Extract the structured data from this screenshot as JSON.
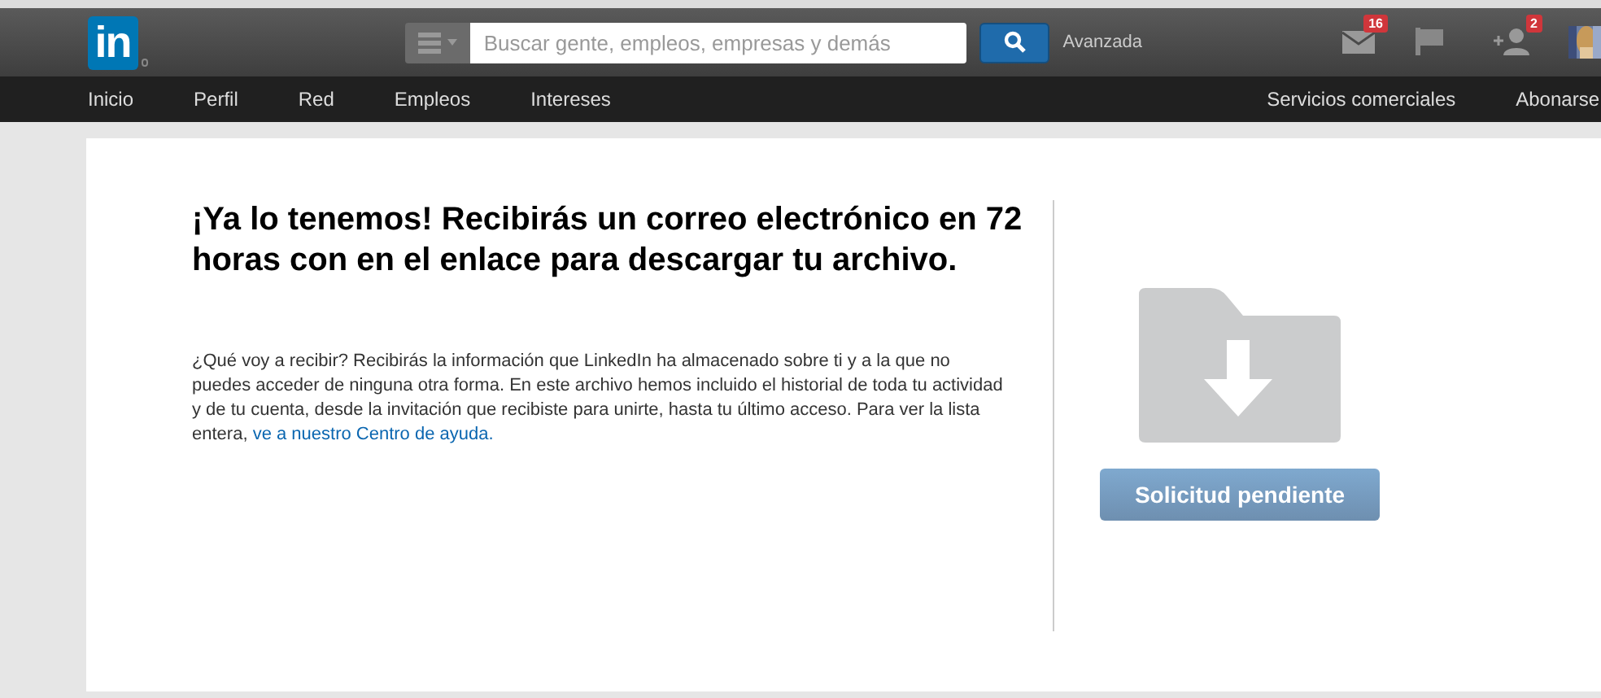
{
  "header": {
    "logo": "in",
    "search": {
      "placeholder": "Buscar gente, empleos, empresas y demás"
    },
    "advanced_link": "Avanzada",
    "notifications": [
      {
        "kind": "mail",
        "count": "16"
      },
      {
        "kind": "flag"
      },
      {
        "kind": "add-contact",
        "count": "2"
      }
    ]
  },
  "nav": {
    "left": [
      {
        "label": "Inicio"
      },
      {
        "label": "Perfil"
      },
      {
        "label": "Red"
      },
      {
        "label": "Empleos"
      },
      {
        "label": "Intereses"
      }
    ],
    "right": [
      {
        "label": "Servicios comerciales"
      },
      {
        "label": "Abonarse"
      }
    ]
  },
  "content": {
    "heading": "¡Ya lo tenemos! Recibirás un correo electrónico en 72 horas con en el enlace para descargar tu archivo.",
    "body": "¿Qué voy a recibir? Recibirás la información que LinkedIn ha almacenado sobre ti y a la que no puedes acceder de ninguna otra forma. En este archivo hemos incluido el historial de toda tu actividad y de tu cuenta, desde la invitación que recibiste para unirte, hasta tu último acceso. Para ver la lista entera, ",
    "link": "ve a nuestro Centro de ayuda.",
    "button": {
      "label": "Solicitud pendiente",
      "disabled": true
    }
  }
}
